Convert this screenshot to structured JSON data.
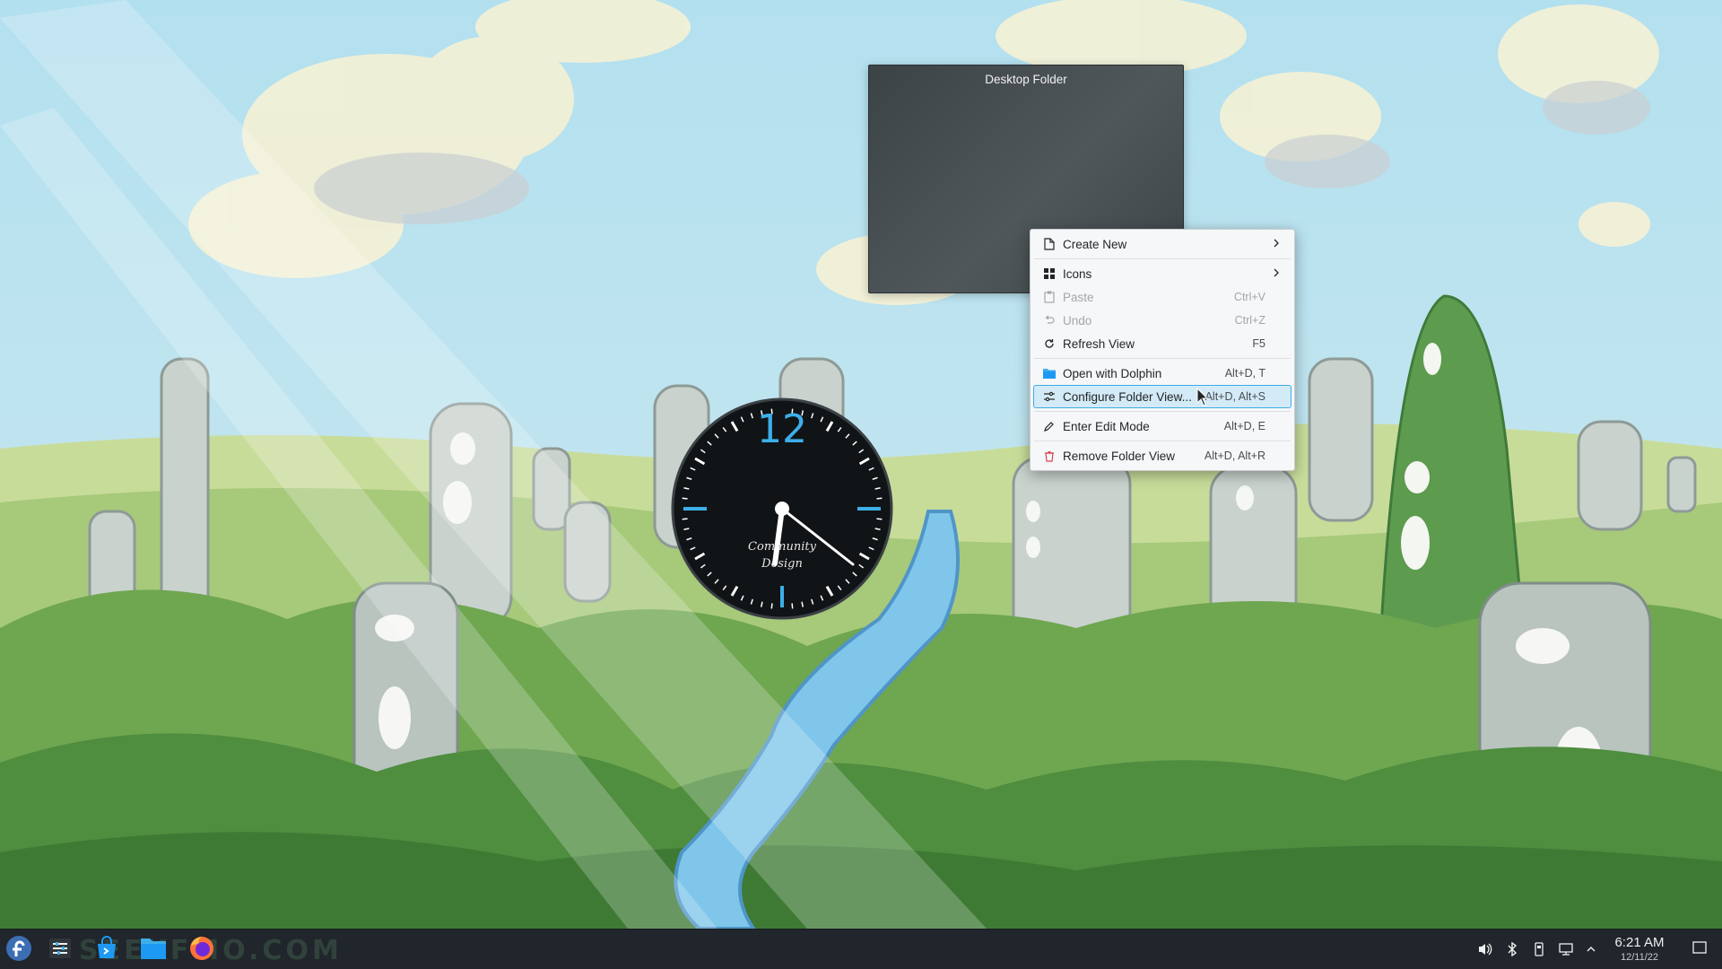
{
  "desktop": {
    "folder_title": "Desktop Folder",
    "clock": {
      "numeral": "12",
      "brand": [
        "Community",
        "Design"
      ],
      "time": "6:21"
    }
  },
  "context_menu": {
    "items": [
      {
        "label": "Create New",
        "shortcut": "",
        "submenu": true,
        "disabled": false,
        "icon": "document-new-icon"
      },
      {
        "label": "Icons",
        "shortcut": "",
        "submenu": true,
        "disabled": false,
        "icon": "grid-icon"
      },
      {
        "label": "Paste",
        "shortcut": "Ctrl+V",
        "submenu": false,
        "disabled": true,
        "icon": "clipboard-icon"
      },
      {
        "label": "Undo",
        "shortcut": "Ctrl+Z",
        "submenu": false,
        "disabled": true,
        "icon": "undo-icon"
      },
      {
        "label": "Refresh View",
        "shortcut": "F5",
        "submenu": false,
        "disabled": false,
        "icon": "refresh-icon"
      },
      {
        "label": "Open with Dolphin",
        "shortcut": "Alt+D, T",
        "submenu": false,
        "disabled": false,
        "icon": "folder-icon"
      },
      {
        "label": "Configure Folder View...",
        "shortcut": "Alt+D, Alt+S",
        "submenu": false,
        "disabled": false,
        "highlighted": true,
        "icon": "configure-icon"
      },
      {
        "label": "Enter Edit Mode",
        "shortcut": "Alt+D, E",
        "submenu": false,
        "disabled": false,
        "icon": "pencil-icon"
      },
      {
        "label": "Remove Folder View",
        "shortcut": "Alt+D, Alt+R",
        "submenu": false,
        "disabled": false,
        "icon": "trash-icon"
      }
    ]
  },
  "taskbar": {
    "launcher_icon": "fedora-logo-icon",
    "tasks": [
      "system-settings-icon",
      "software-center-icon",
      "file-manager-icon",
      "firefox-icon"
    ],
    "tray": [
      "volume-icon",
      "bluetooth-icon",
      "storage-icon",
      "network-icon",
      "expand-tray-icon"
    ],
    "time": "6:21 AM",
    "date": "12/11/22",
    "watermark": "SEEKFMO.COM"
  },
  "colors": {
    "accent": "#3daee9",
    "panel": "#20262b",
    "menu_bg": "#f6f7f8"
  }
}
